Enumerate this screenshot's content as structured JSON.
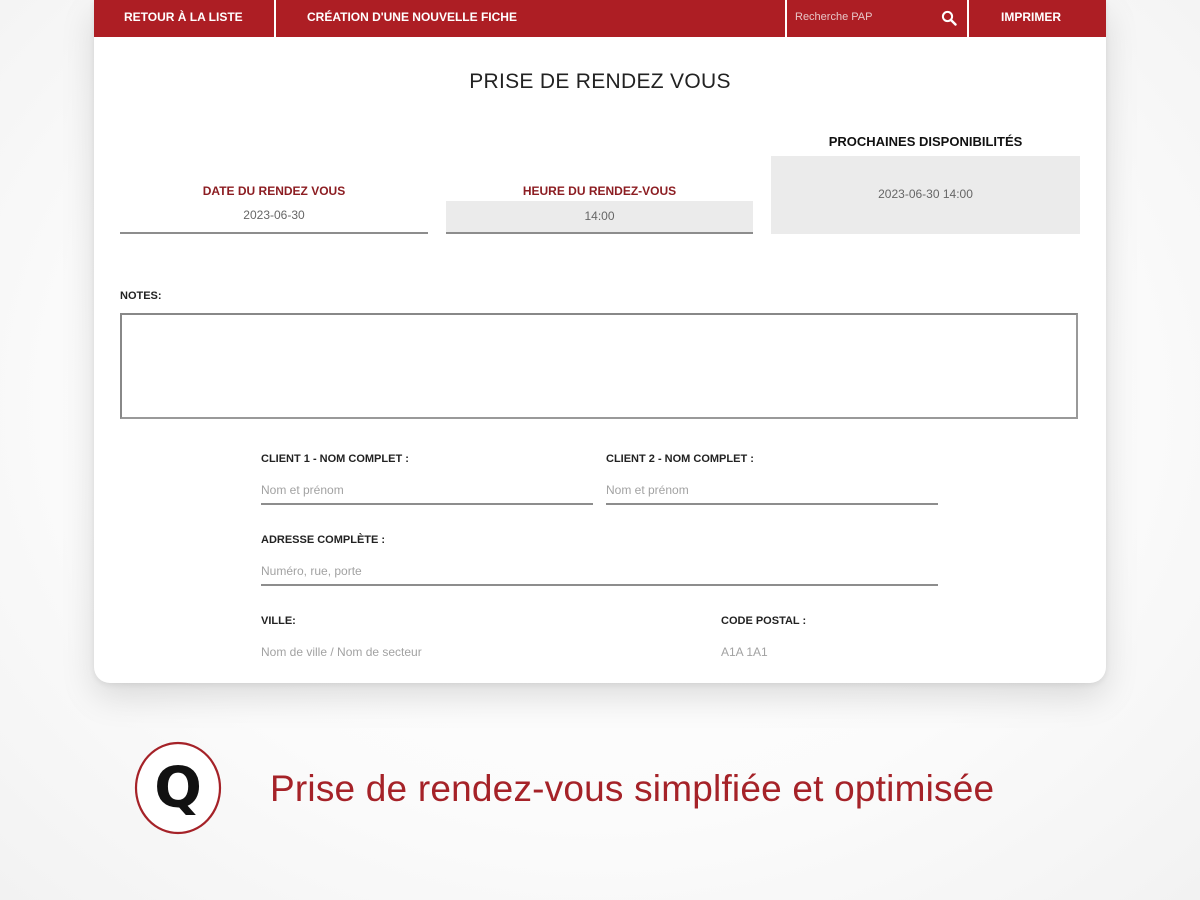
{
  "nav": {
    "back_label": "Retour à la liste",
    "new_label": "Création d'une nouvelle fiche",
    "search_placeholder": "Recherche PAP",
    "print_label": "Imprimer"
  },
  "page": {
    "title": "PRISE DE RENDEZ VOUS"
  },
  "appointment": {
    "date_label": "DATE DU RENDEZ VOUS",
    "date_value": "2023-06-30",
    "time_label": "HEURE DU RENDEZ-VOUS",
    "time_value": "14:00",
    "availability_title": "PROCHAINES DISPONIBILITÉS",
    "availability_value": "2023-06-30 14:00"
  },
  "notes": {
    "label": "NOTES:",
    "value": ""
  },
  "client": {
    "client1_label": "CLIENT 1 - NOM COMPLET :",
    "client1_placeholder": "Nom et prénom",
    "client2_label": "CLIENT 2 - NOM COMPLET :",
    "client2_placeholder": "Nom et prénom",
    "address_label": "ADRESSE COMPLÈTE :",
    "address_placeholder": "Numéro, rue, porte",
    "city_label": "VILLE:",
    "city_placeholder": "Nom de ville / Nom de secteur",
    "postal_label": "CODE POSTAL :",
    "postal_placeholder": "A1A 1A1"
  },
  "branding": {
    "logo_letter": "Q",
    "tagline": "Prise de rendez-vous simplfiée et optimisée"
  },
  "colors": {
    "brand_red": "#ad1e24",
    "label_red": "#8c1d22",
    "tagline_red": "#a52228",
    "field_grey": "#ebebeb"
  },
  "icons": {
    "search": "search-icon",
    "logo": "q-logo-icon"
  }
}
